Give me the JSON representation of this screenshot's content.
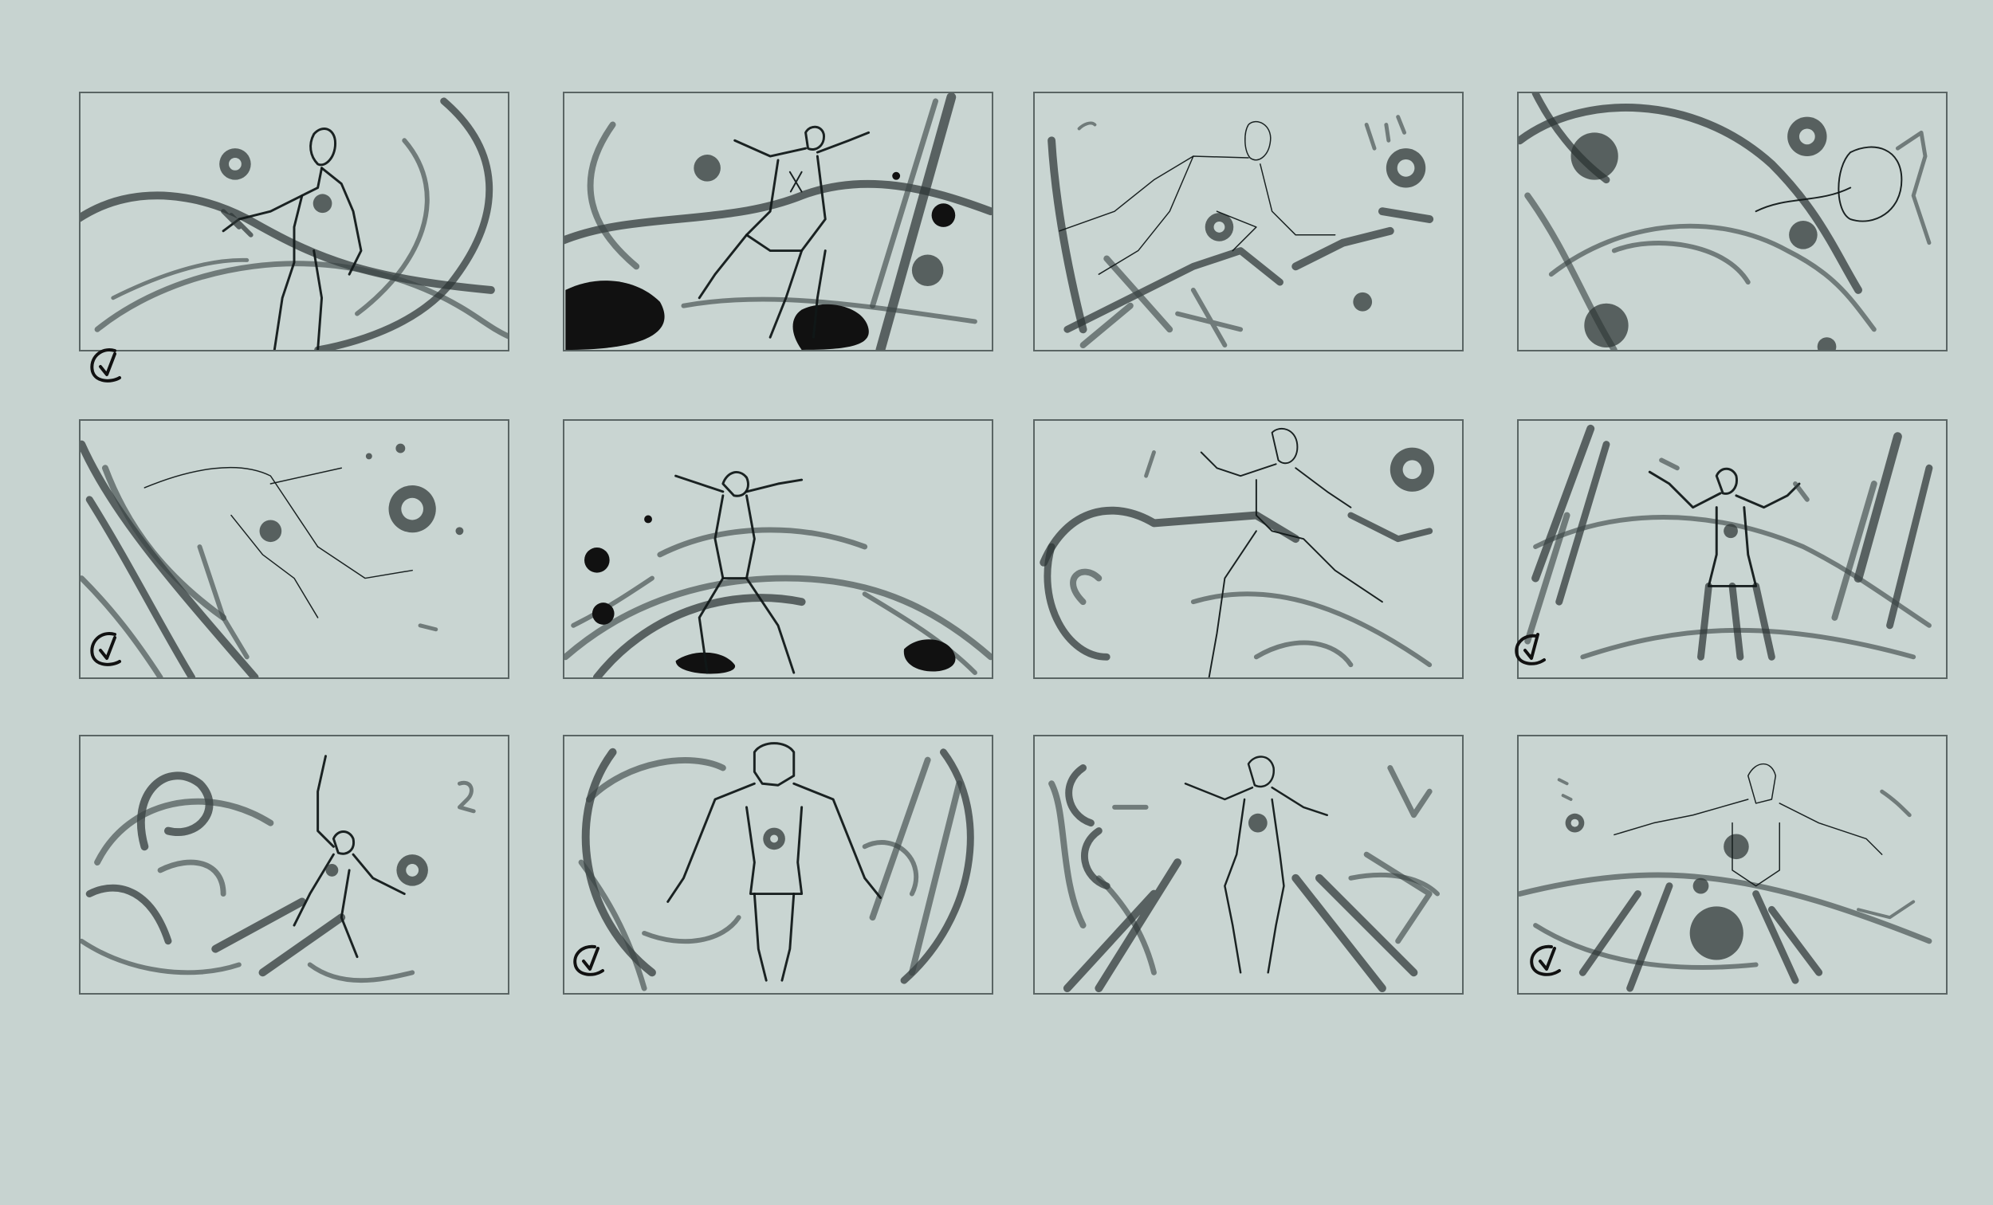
{
  "board": {
    "background": "#c7d3d0",
    "panel_count": 12,
    "panels": [
      {
        "id": 1,
        "approved": true
      },
      {
        "id": 2,
        "approved": false
      },
      {
        "id": 3,
        "approved": false
      },
      {
        "id": 4,
        "approved": false
      },
      {
        "id": 5,
        "approved": true
      },
      {
        "id": 6,
        "approved": false
      },
      {
        "id": 7,
        "approved": false
      },
      {
        "id": 8,
        "approved": true
      },
      {
        "id": 9,
        "approved": false
      },
      {
        "id": 10,
        "approved": true
      },
      {
        "id": 11,
        "approved": false
      },
      {
        "id": 12,
        "approved": true
      }
    ]
  }
}
